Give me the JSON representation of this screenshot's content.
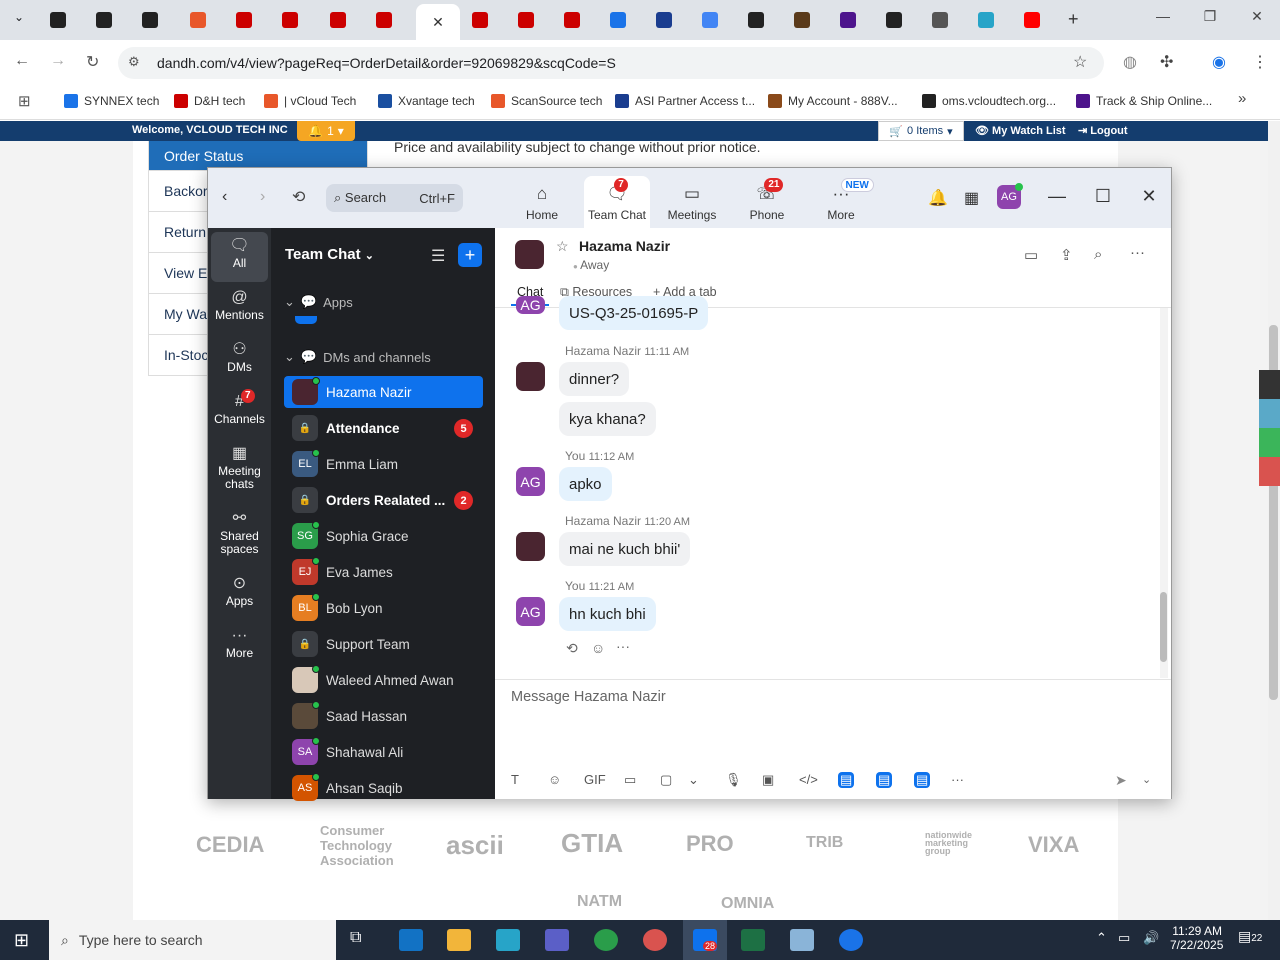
{
  "browser": {
    "url": "dandh.com/v4/view?pageReq=OrderDetail&order=92069829&scqCode=S",
    "tabs": [
      {
        "icon": "amazon-icon",
        "color": "#222"
      },
      {
        "icon": "triangle-logo-icon",
        "color": "#222"
      },
      {
        "icon": "amazon-icon",
        "color": "#222"
      },
      {
        "icon": "scansource-icon",
        "color": "#e8572a"
      },
      {
        "icon": "dh-icon",
        "color": "#c00"
      },
      {
        "icon": "dh-icon",
        "color": "#c00"
      },
      {
        "icon": "dh-icon",
        "color": "#c00"
      },
      {
        "icon": "dh-icon",
        "color": "#c00"
      },
      {
        "icon": "blank-icon",
        "color": "#fff"
      },
      {
        "icon": "dh-icon",
        "color": "#c00"
      },
      {
        "icon": "dh-icon",
        "color": "#c00"
      },
      {
        "icon": "dh-icon",
        "color": "#c00"
      },
      {
        "icon": "ec-icon",
        "color": "#1a73e8"
      },
      {
        "icon": "asi-icon",
        "color": "#1a3d8f"
      },
      {
        "icon": "google-icon",
        "color": "#4285f4"
      },
      {
        "icon": "amazon-icon",
        "color": "#222"
      },
      {
        "icon": "ups-icon",
        "color": "#5a3a1a"
      },
      {
        "icon": "fedex-icon",
        "color": "#4d148c"
      },
      {
        "icon": "openai-icon",
        "color": "#222"
      },
      {
        "icon": "group-icon",
        "color": "#555"
      },
      {
        "icon": "hex-icon",
        "color": "#27a4c8"
      },
      {
        "icon": "youtube-icon",
        "color": "#f00"
      }
    ],
    "bookmarks": [
      {
        "label": "SYNNEX tech",
        "color": "#1a73e8"
      },
      {
        "label": "D&H tech",
        "color": "#c00"
      },
      {
        "label": "| vCloud Tech",
        "color": "#e8572a"
      },
      {
        "label": "Xvantage tech",
        "color": "#1a4fa0"
      },
      {
        "label": "ScanSource tech",
        "color": "#e8572a"
      },
      {
        "label": "ASI Partner Access t...",
        "color": "#1a3d8f"
      },
      {
        "label": "My Account - 888V...",
        "color": "#8a4a1a"
      },
      {
        "label": "oms.vcloudtech.org...",
        "color": "#222"
      },
      {
        "label": "Track & Ship Online...",
        "color": "#4d148c"
      }
    ]
  },
  "site": {
    "welcome": "Welcome, VCLOUD TECH INC",
    "alert_count": "1",
    "cart": "0 Items",
    "watch_list": "My Watch List",
    "logout": "Logout",
    "menu": [
      "Order Status",
      "Backor",
      "Return",
      "View E",
      "My Wat",
      "In-Stoc"
    ],
    "price_note": "Price and availability subject to change without prior notice.",
    "logos": [
      "CEDIA",
      "Consumer",
      "Technology",
      "Association",
      "ascii",
      "GTIA",
      "PRO",
      "TRIB",
      "nationwide",
      "marketing",
      "group",
      "VIXA",
      "NATM",
      "OMNIA"
    ]
  },
  "zoom": {
    "search": "Search",
    "search_shortcut": "Ctrl+F",
    "nav": [
      {
        "label": "Home",
        "icon": "home-icon"
      },
      {
        "label": "Team Chat",
        "icon": "chat-icon",
        "badge": "7"
      },
      {
        "label": "Meetings",
        "icon": "video-icon"
      },
      {
        "label": "Phone",
        "icon": "phone-icon",
        "badge": "21"
      },
      {
        "label": "More",
        "icon": "more-icon",
        "badge": "NEW"
      }
    ],
    "rail": [
      {
        "label": "All",
        "icon": "chat-bubble-icon"
      },
      {
        "label": "Mentions",
        "icon": "at-icon"
      },
      {
        "label": "DMs",
        "icon": "people-icon"
      },
      {
        "label": "Channels",
        "icon": "hash-icon",
        "badge": "7"
      },
      {
        "label": "Meeting",
        "label2": "chats",
        "icon": "calendar-icon"
      },
      {
        "label": "Shared",
        "label2": "spaces",
        "icon": "share-icon"
      },
      {
        "label": "Apps",
        "icon": "apps-icon"
      },
      {
        "label": "More",
        "icon": "ellipsis-icon"
      }
    ],
    "list_title": "Team Chat",
    "section_apps": "Apps",
    "section_dms": "DMs and channels",
    "channels": [
      {
        "name": "Hazama Nazir",
        "initials": "",
        "color": "#4a2530",
        "selected": true
      },
      {
        "name": "Attendance",
        "initials": "",
        "color": "#3a3d42",
        "lock": true,
        "bold": true,
        "count": "5"
      },
      {
        "name": "Emma Liam",
        "initials": "EL",
        "color": "#3a5a80"
      },
      {
        "name": "Orders Realated ...",
        "initials": "",
        "color": "#3a3d42",
        "lock": true,
        "bold": true,
        "count": "2"
      },
      {
        "name": "Sophia Grace",
        "initials": "SG",
        "color": "#2a9d4a"
      },
      {
        "name": "Eva James",
        "initials": "EJ",
        "color": "#c0392b"
      },
      {
        "name": "Bob Lyon",
        "initials": "BL",
        "color": "#e67e22"
      },
      {
        "name": "Support Team",
        "initials": "",
        "color": "#3a3d42",
        "lock": true
      },
      {
        "name": "Waleed Ahmed Awan",
        "initials": "",
        "color": "#d8c8b8"
      },
      {
        "name": "Saad Hassan",
        "initials": "",
        "color": "#5a4a3a"
      },
      {
        "name": "Shahawal Ali",
        "initials": "SA",
        "color": "#8e44ad"
      },
      {
        "name": "Ahsan Saqib",
        "initials": "AS",
        "color": "#d35400"
      }
    ],
    "chat": {
      "name": "Hazama Nazir",
      "status": "Away",
      "tabs": [
        "Chat",
        "Resources",
        "Add a tab"
      ],
      "messages": [
        {
          "text": "US-Q3-25-01695-P",
          "out": true,
          "initials": "AG"
        },
        {
          "meta": "Hazama Nazir",
          "time": "11:11 AM",
          "text": "dinner?",
          "out": false
        },
        {
          "text": "kya khana?",
          "out": false
        },
        {
          "meta": "You",
          "time": "11:12 AM",
          "text": "apko",
          "out": true,
          "initials": "AG"
        },
        {
          "meta": "Hazama Nazir",
          "time": "11:20 AM",
          "text": "mai ne kuch bhii'",
          "out": false
        },
        {
          "meta": "You",
          "time": "11:21 AM",
          "text": "hn kuch bhi",
          "out": true,
          "initials": "AG"
        }
      ],
      "compose_placeholder": "Message Hazama Nazir",
      "toolbar": [
        "T",
        "☺",
        "GIF",
        "▭",
        "▢",
        "⌄",
        "🎙",
        "▣",
        "</>",
        "▤",
        "▤",
        "▤",
        "···"
      ]
    },
    "user_initials": "AG"
  },
  "taskbar": {
    "search": "Type here to search",
    "time": "11:29 AM",
    "date": "7/22/2025",
    "notif": "22",
    "zoom_badge": "28"
  },
  "colors": {
    "zoom_blue": "#0e72ed",
    "dh_navy": "#143d6e",
    "accent_orange": "#f5a623"
  }
}
